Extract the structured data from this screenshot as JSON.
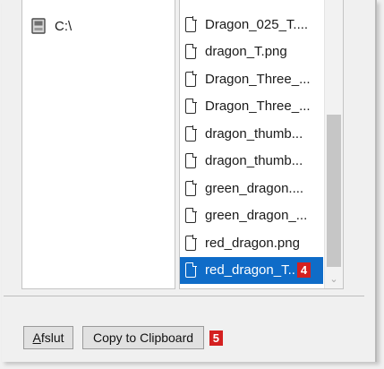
{
  "tree": {
    "drive": {
      "label": "C:\\",
      "icon": "drive-icon"
    }
  },
  "files": [
    {
      "name": "Dragon_025_T....",
      "icon": "file-icon",
      "selected": false
    },
    {
      "name": "dragon_T.png",
      "icon": "file-icon",
      "selected": false
    },
    {
      "name": "Dragon_Three_...",
      "icon": "file-icon",
      "selected": false
    },
    {
      "name": "Dragon_Three_...",
      "icon": "file-icon",
      "selected": false
    },
    {
      "name": "dragon_thumb...",
      "icon": "file-icon",
      "selected": false
    },
    {
      "name": "dragon_thumb...",
      "icon": "file-icon",
      "selected": false
    },
    {
      "name": "green_dragon....",
      "icon": "file-icon",
      "selected": false
    },
    {
      "name": "green_dragon_...",
      "icon": "file-icon",
      "selected": false
    },
    {
      "name": "red_dragon.png",
      "icon": "file-icon",
      "selected": false
    },
    {
      "name": "red_dragon_T..",
      "icon": "file-icon",
      "selected": true,
      "badge": "4"
    }
  ],
  "buttons": {
    "exit": {
      "first": "A",
      "rest": "fslut"
    },
    "copy": {
      "label": "Copy to Clipboard",
      "badge": "5"
    }
  },
  "status_text": "",
  "colors": {
    "selection": "#0f6cc8",
    "badge": "#d42020"
  }
}
